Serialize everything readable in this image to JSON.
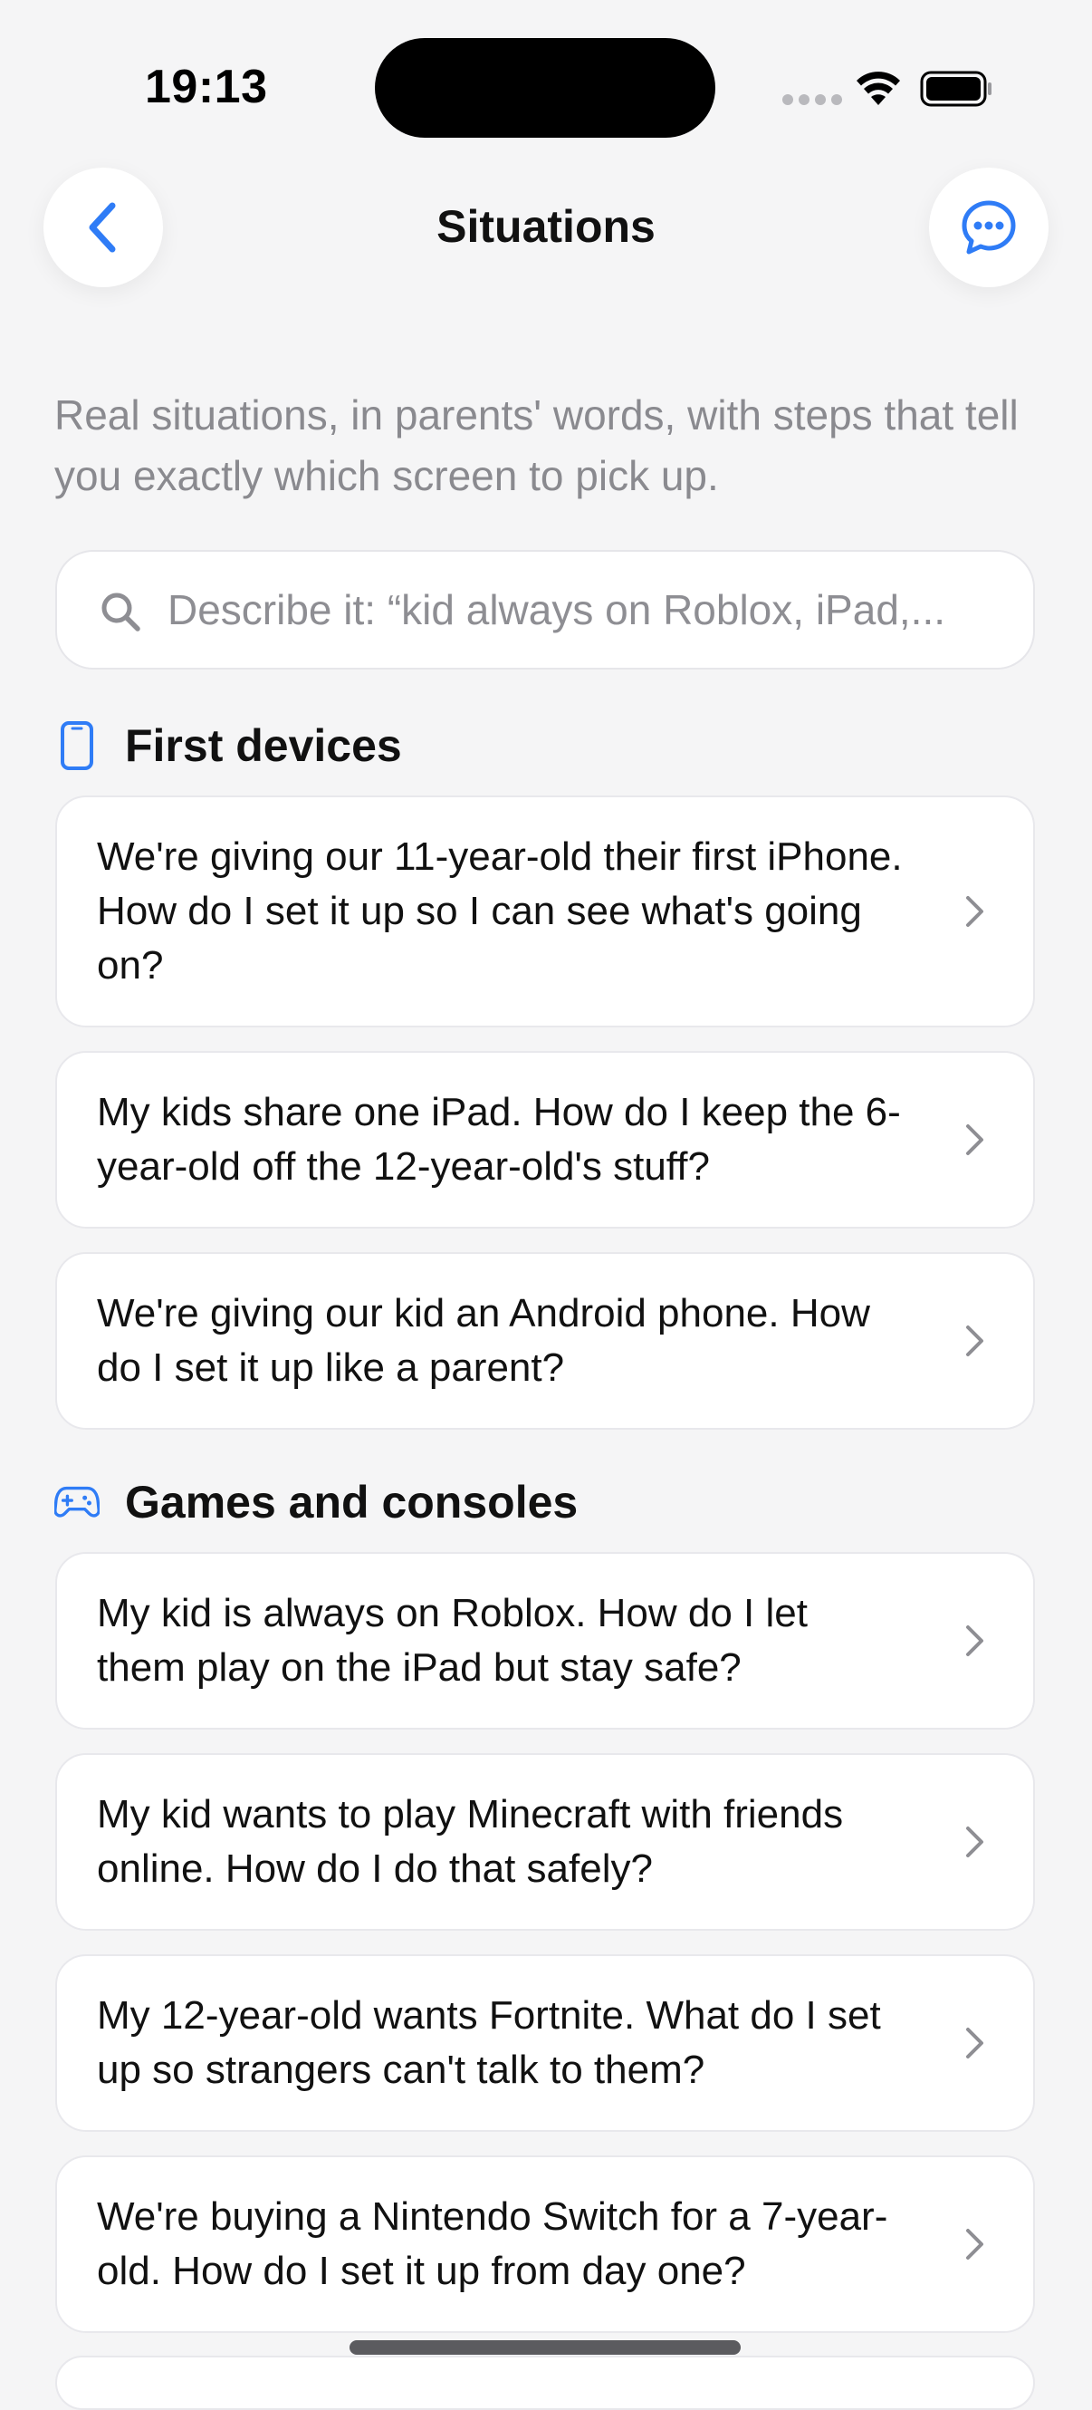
{
  "status_bar": {
    "time": "19:13"
  },
  "nav": {
    "title": "Situations",
    "back_icon": "chevron-left-icon",
    "chat_icon": "chat-bubble-icon"
  },
  "intro": "Real situations, in parents' words, with steps that tell you exactly which screen to pick up.",
  "search": {
    "placeholder": "Describe it: “kid always on Roblox, iPad,...",
    "value": ""
  },
  "sections": [
    {
      "title": "First devices",
      "icon": "phone-icon",
      "items": [
        "We're giving our 11-year-old their first iPhone. How do I set it up so I can see what's going on?",
        "My kids share one iPad. How do I keep the 6-year-old off the 12-year-old's stuff?",
        "We're giving our kid an Android phone. How do I set it up like a parent?"
      ]
    },
    {
      "title": "Games and consoles",
      "icon": "gamepad-icon",
      "items": [
        "My kid is always on Roblox. How do I let them play on the iPad but stay safe?",
        "My kid wants to play Minecraft with friends online. How do I do that safely?",
        "My 12-year-old wants Fortnite. What do I set up so strangers can't talk to them?",
        "We're buying a Nintendo Switch for a 7-year-old. How do I set it up from day one?"
      ]
    }
  ],
  "colors": {
    "accent": "#2f7cf6",
    "background": "#f5f5f6",
    "card": "#ffffff",
    "muted_text": "#8a8a8f"
  }
}
